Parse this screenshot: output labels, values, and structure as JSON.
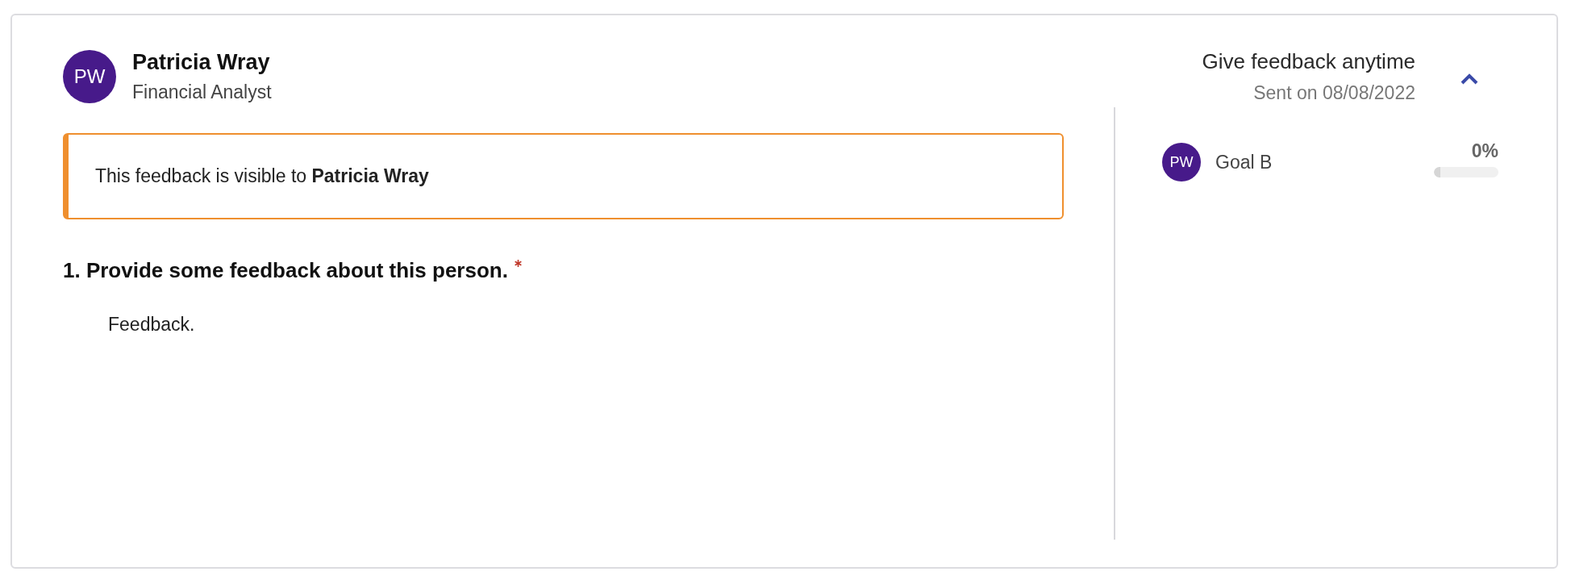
{
  "person": {
    "initials": "PW",
    "name": "Patricia Wray",
    "role": "Financial Analyst"
  },
  "header": {
    "title": "Give feedback anytime",
    "sent": "Sent on 08/08/2022",
    "expanded": true
  },
  "notice": {
    "text": "This feedback is visible to **Patricia Wray**"
  },
  "questions": [
    {
      "number": "1.",
      "text": "Provide some feedback about this person.",
      "required": true,
      "answer": "Feedback."
    }
  ],
  "goals": [
    {
      "initials": "PW",
      "name": "Goal B",
      "reading": "0%",
      "level": 0
    }
  ]
}
